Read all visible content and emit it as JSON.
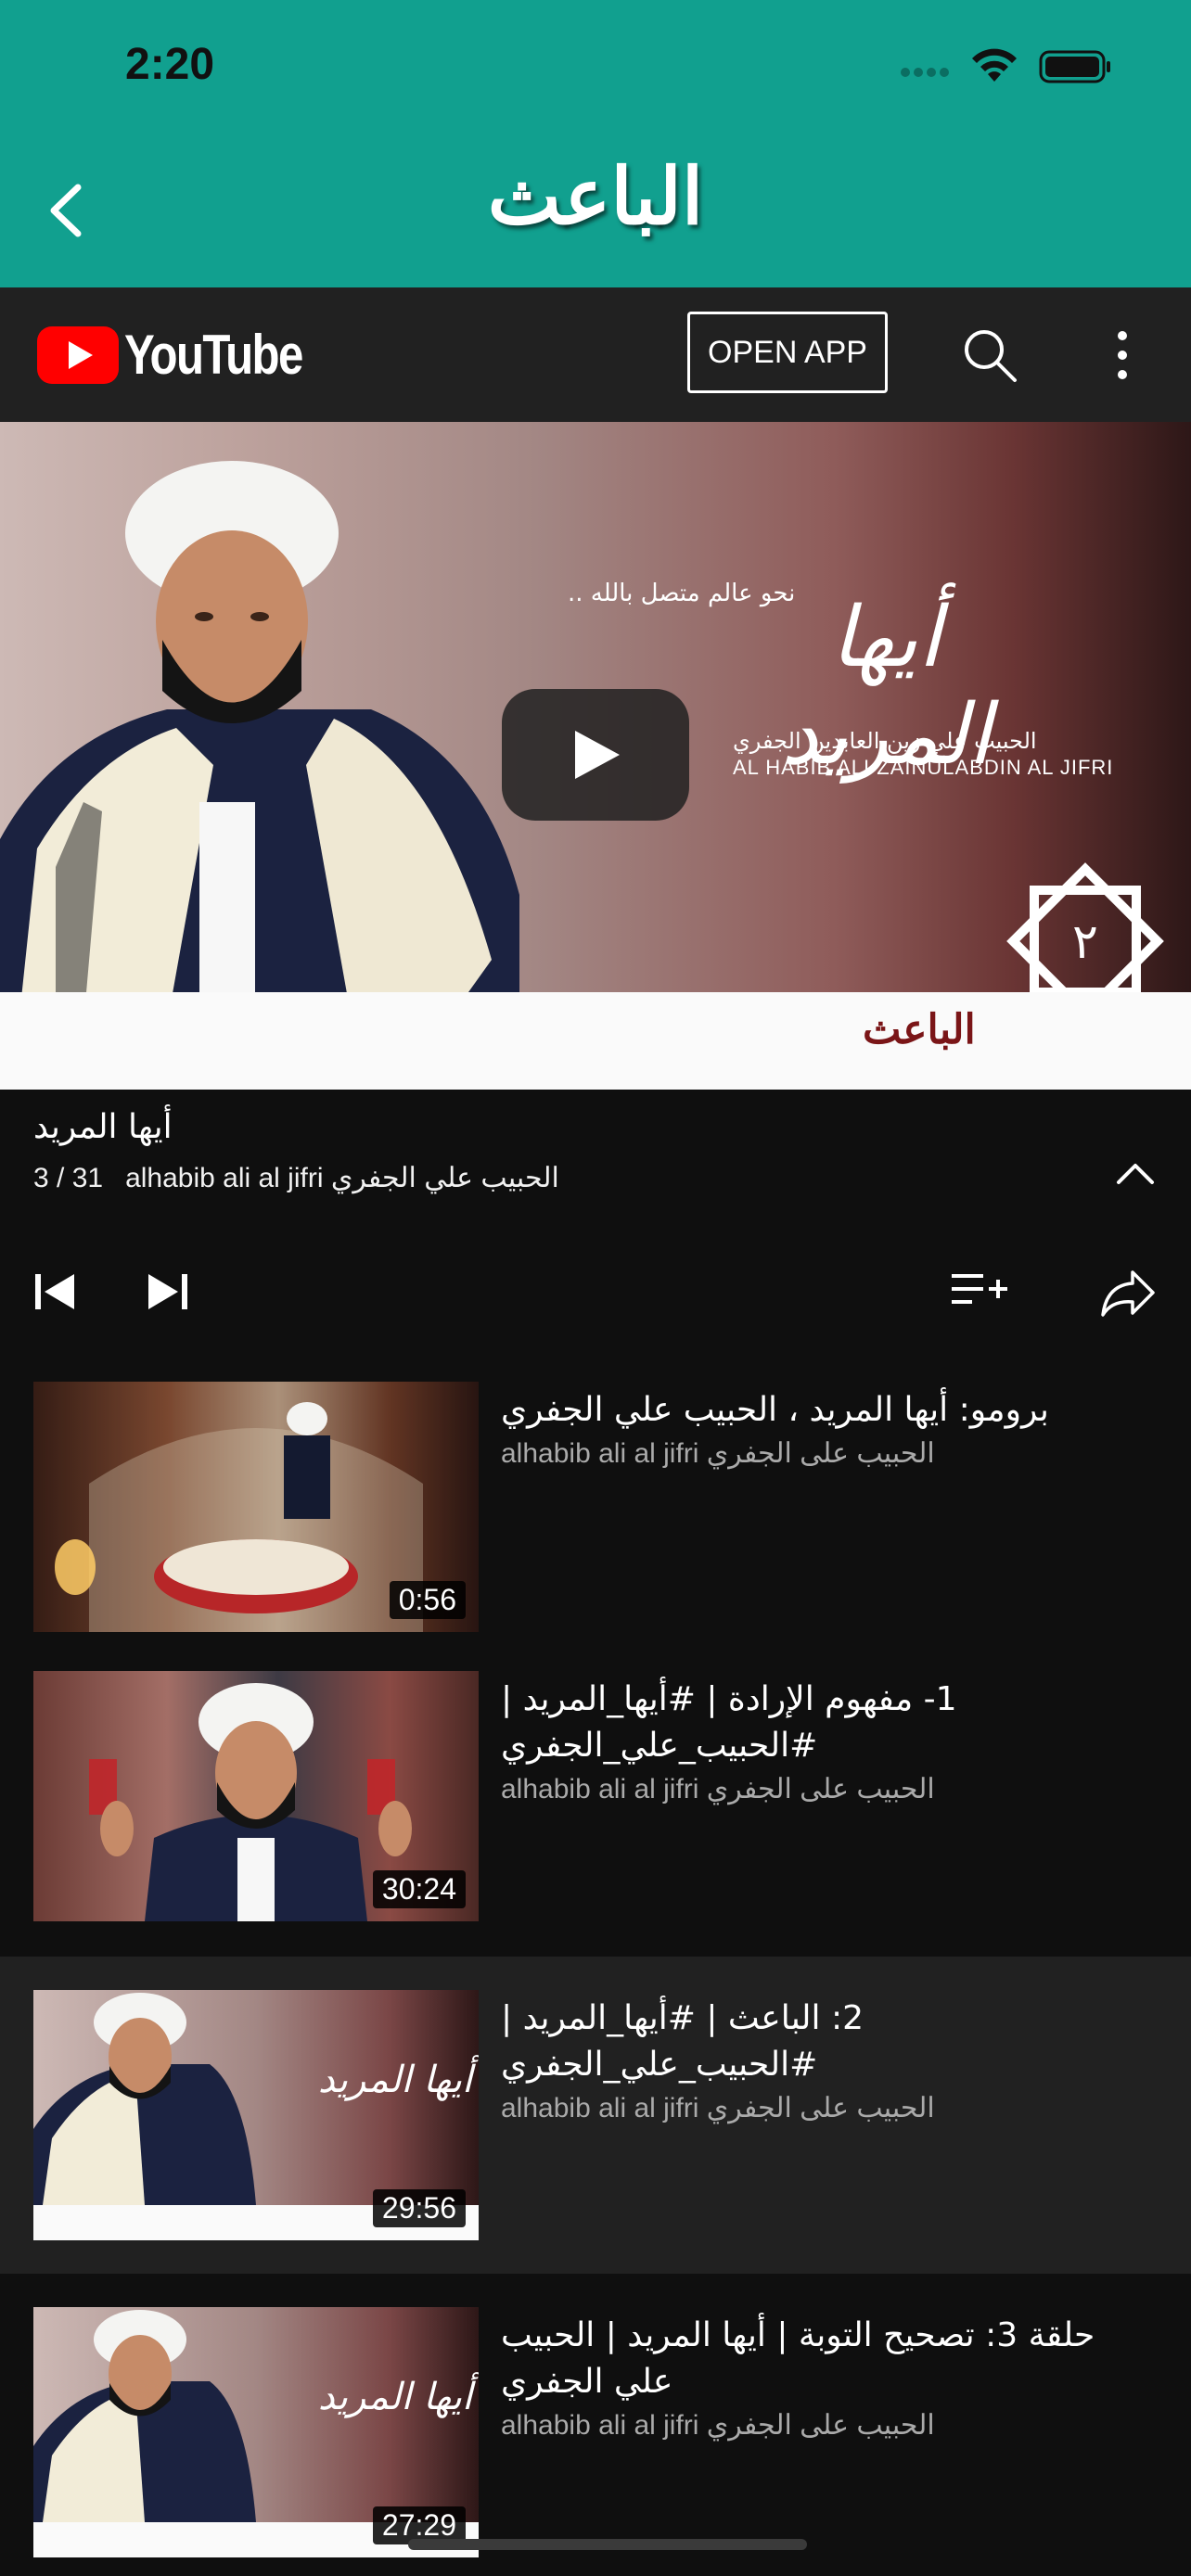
{
  "status_bar": {
    "time": "2:20"
  },
  "app_bar": {
    "title": "الباعث"
  },
  "youtube_header": {
    "wordmark": "YouTube",
    "open_app_label": "OPEN APP"
  },
  "player": {
    "strip_title": "الباعث",
    "calligraphy": "أيها المريد",
    "caption_top": "نحو عالم متصل بالله ..",
    "caption_ar": "الحبيب علي زين العابدين الجفري",
    "caption_en": "AL HABIB ALI ZAINULABDIN AL JIFRI",
    "badge_number": "٢"
  },
  "playlist": {
    "title": "أيها المريد",
    "position": "3 / 31",
    "channel": "alhabib ali al jifri الحبيب علي الجفري"
  },
  "videos": [
    {
      "title": "برومو: أيها المريد ، الحبيب علي الجفري",
      "channel": "alhabib ali al jifri الحبيب على الجفري",
      "duration": "0:56",
      "active": false
    },
    {
      "title": "1- مفهوم الإرادة | #أيها_المريد | #الحبيب_علي_الجفري",
      "channel": "alhabib ali al jifri الحبيب على الجفري",
      "duration": "30:24",
      "active": false
    },
    {
      "title": "2: الباعث | #أيها_المريد | #الحبيب_علي_الجفري",
      "channel": "alhabib ali al jifri الحبيب على الجفري",
      "duration": "29:56",
      "active": true
    },
    {
      "title": "حلقة 3: تصحيح التوبة | أيها المريد | الحبيب علي الجفري",
      "channel": "alhabib ali al jifri الحبيب على الجفري",
      "duration": "27:29",
      "active": false
    }
  ],
  "colors": {
    "app_bar": "#11a08f",
    "yt_header": "#212121",
    "background": "#0f0f0f",
    "youtube_red": "#ff0000"
  }
}
